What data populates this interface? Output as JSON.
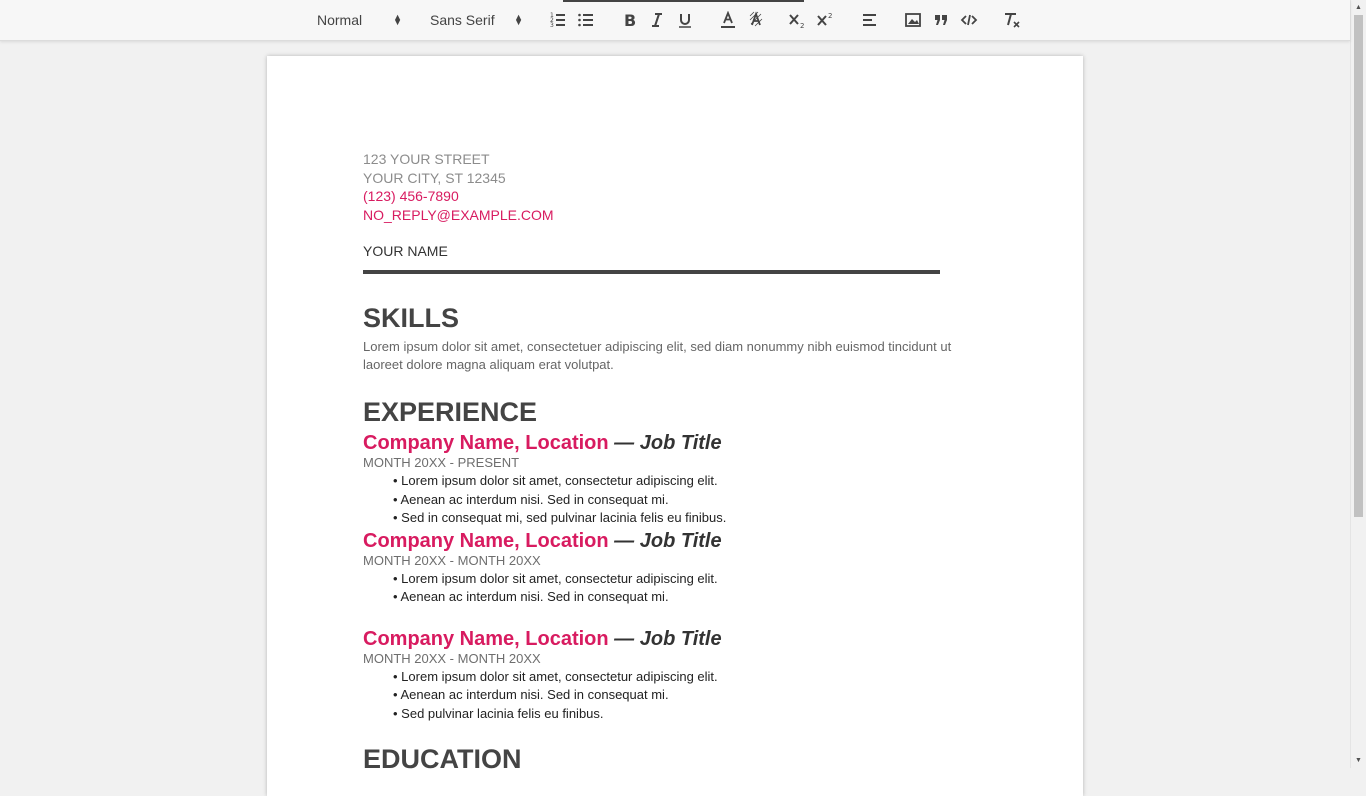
{
  "toolbar": {
    "format_select": "Normal",
    "font_select": "Sans Serif"
  },
  "icons": {
    "ordered_list": "ordered-list-icon",
    "bullet_list": "bullet-list-icon",
    "bold": "bold-icon",
    "italic": "italic-icon",
    "underline": "underline-icon",
    "text_color": "text-color-icon",
    "background_color": "highlight-icon",
    "subscript": "subscript-icon",
    "superscript": "superscript-icon",
    "align": "align-left-icon",
    "image": "image-icon",
    "blockquote": "quote-icon",
    "code": "code-icon",
    "clear": "clear-format-icon"
  },
  "colors": {
    "accent": "#d81b60",
    "heading": "#444444"
  },
  "resume": {
    "street": "123 YOUR STREET",
    "city": "YOUR CITY, ST 12345",
    "phone": "(123) 456-7890",
    "email": "NO_REPLY@EXAMPLE.COM",
    "name": "YOUR NAME",
    "skills_heading": "SKILLS",
    "skills_text": "Lorem ipsum dolor sit amet, consectetuer adipiscing elit, sed diam nonummy nibh euismod tincidunt ut laoreet dolore magna aliquam erat volutpat.",
    "experience_heading": "EXPERIENCE",
    "jobs": [
      {
        "company": "Company Name, Location",
        "title": " — Job Title",
        "dates": "MONTH 20XX - PRESENT",
        "items": [
          "Lorem ipsum dolor sit amet, consectetur adipiscing elit.",
          "Aenean ac interdum nisi. Sed in consequat mi.",
          "Sed in consequat mi, sed pulvinar lacinia felis eu finibus."
        ]
      },
      {
        "company": "Company Name, Location",
        "title": " — Job Title",
        "dates": "MONTH 20XX - MONTH 20XX",
        "items": [
          "Lorem ipsum dolor sit amet, consectetur adipiscing elit.",
          "Aenean ac interdum nisi. Sed in consequat mi."
        ]
      },
      {
        "company": "Company Name, Location",
        "title": " — Job Title",
        "dates": "MONTH 20XX - MONTH 20XX",
        "items": [
          "Lorem ipsum dolor sit amet, consectetur adipiscing elit.",
          "Aenean ac interdum nisi. Sed in consequat mi.",
          "Sed pulvinar lacinia felis eu finibus."
        ]
      }
    ],
    "education_heading": "EDUCATION"
  }
}
